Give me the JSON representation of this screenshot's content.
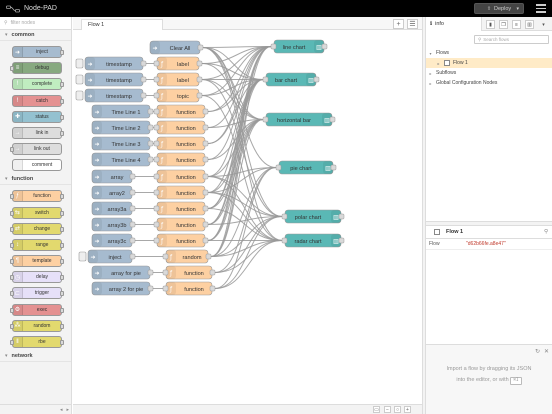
{
  "header": {
    "app_title": "Node-PAD",
    "deploy_label": "Deploy"
  },
  "palette": {
    "search_placeholder": "filter nodes",
    "categories": [
      {
        "name": "common",
        "nodes": [
          {
            "label": "inject",
            "color": "#a6bbcf",
            "icon": "arrow-right-icon"
          },
          {
            "label": "debug",
            "color": "#87a980",
            "icon": "bug-icon"
          },
          {
            "label": "complete",
            "color": "#c0edc0",
            "icon": "exclamation-icon"
          },
          {
            "label": "catch",
            "color": "#e49191",
            "icon": "exclamation-icon"
          },
          {
            "label": "status",
            "color": "#94c1d0",
            "icon": "status-icon"
          },
          {
            "label": "link in",
            "color": "#dddddd",
            "icon": "link-icon"
          },
          {
            "label": "link out",
            "color": "#dddddd",
            "icon": "link-icon"
          },
          {
            "label": "comment",
            "color": "#ffffff",
            "icon": "comment-icon"
          }
        ]
      },
      {
        "name": "function",
        "nodes": [
          {
            "label": "function",
            "color": "#fdd0a2",
            "icon": "function-icon"
          },
          {
            "label": "switch",
            "color": "#e2d96e",
            "icon": "switch-icon"
          },
          {
            "label": "change",
            "color": "#e2d96e",
            "icon": "change-icon"
          },
          {
            "label": "range",
            "color": "#e2d96e",
            "icon": "range-icon"
          },
          {
            "label": "template",
            "color": "#fdd0a2",
            "icon": "template-icon"
          },
          {
            "label": "delay",
            "color": "#e6e0f8",
            "icon": "clock-icon"
          },
          {
            "label": "trigger",
            "color": "#e6e0f8",
            "icon": "trigger-icon"
          },
          {
            "label": "exec",
            "color": "#e49191",
            "icon": "cog-icon"
          },
          {
            "label": "random",
            "color": "#e2d96e",
            "icon": "random-icon"
          },
          {
            "label": "rbe",
            "color": "#e2d96e",
            "icon": "rbe-icon"
          }
        ]
      },
      {
        "name": "network",
        "nodes": []
      }
    ]
  },
  "workspace": {
    "tab_label": "Flow 1",
    "add_tab": "+",
    "list_tabs": "☰",
    "zoom_out": "−",
    "zoom_reset": "○",
    "zoom_in": "+"
  },
  "flow": {
    "nodes": [
      {
        "id": "clear",
        "label": "Clear All",
        "type": "inject"
      },
      {
        "id": "ts1",
        "label": "timestamp",
        "type": "inject-btn"
      },
      {
        "id": "ts2",
        "label": "timestamp",
        "type": "inject-btn"
      },
      {
        "id": "ts3",
        "label": "timestamp",
        "type": "inject-btn"
      },
      {
        "id": "tl1",
        "label": "Time Line 1",
        "type": "inject"
      },
      {
        "id": "tl2",
        "label": "Time Line 2",
        "type": "inject"
      },
      {
        "id": "tl3",
        "label": "Time Line 3",
        "type": "inject"
      },
      {
        "id": "tl4",
        "label": "Time Line 4",
        "type": "inject"
      },
      {
        "id": "ar",
        "label": "array",
        "type": "inject"
      },
      {
        "id": "ar2",
        "label": "array2",
        "type": "inject"
      },
      {
        "id": "ar3a",
        "label": "array3a",
        "type": "inject"
      },
      {
        "id": "ar3b",
        "label": "array3b",
        "type": "inject"
      },
      {
        "id": "ar3c",
        "label": "array3c",
        "type": "inject"
      },
      {
        "id": "inj",
        "label": "inject",
        "type": "inject-btn"
      },
      {
        "id": "afp",
        "label": "array for pie",
        "type": "inject"
      },
      {
        "id": "a2p",
        "label": "array 2 for pie",
        "type": "inject"
      },
      {
        "id": "f_label1",
        "label": "label",
        "type": "function"
      },
      {
        "id": "f_label2",
        "label": "label",
        "type": "function"
      },
      {
        "id": "f_topic",
        "label": "topic",
        "type": "function"
      },
      {
        "id": "f1",
        "label": "function",
        "type": "function"
      },
      {
        "id": "f2",
        "label": "function",
        "type": "function"
      },
      {
        "id": "f3",
        "label": "function",
        "type": "function"
      },
      {
        "id": "f4",
        "label": "function",
        "type": "function"
      },
      {
        "id": "f5",
        "label": "function",
        "type": "function"
      },
      {
        "id": "f6",
        "label": "function",
        "type": "function"
      },
      {
        "id": "f7",
        "label": "function",
        "type": "function"
      },
      {
        "id": "f8",
        "label": "function",
        "type": "function"
      },
      {
        "id": "f9",
        "label": "function",
        "type": "function"
      },
      {
        "id": "rnd",
        "label": "random",
        "type": "function"
      },
      {
        "id": "fp1",
        "label": "function",
        "type": "function"
      },
      {
        "id": "fp2",
        "label": "function",
        "type": "function"
      },
      {
        "id": "c_line",
        "label": "line chart",
        "type": "chart"
      },
      {
        "id": "c_bar",
        "label": "bar chart",
        "type": "chart"
      },
      {
        "id": "c_hbar",
        "label": "horizontal bar",
        "type": "chart"
      },
      {
        "id": "c_pie",
        "label": "pie chart",
        "type": "chart"
      },
      {
        "id": "c_polar",
        "label": "polar chart",
        "type": "chart"
      },
      {
        "id": "c_radar",
        "label": "radar chart",
        "type": "chart"
      }
    ]
  },
  "sidebar": {
    "tab_label": "info",
    "search_placeholder": "Search flows",
    "tree": {
      "flows_label": "Flows",
      "flow1_label": "Flow 1",
      "subflows_label": "Subflows",
      "global_label": "Global Configuration Nodes"
    },
    "info": {
      "title": "Flow 1",
      "key": "Flow",
      "value": "\"d62b66fe.a8e47\""
    },
    "help": {
      "line1": "Import a flow by dragging its JSON",
      "line2": "into the editor, or with",
      "shortcut": "⌘I"
    }
  },
  "colors": {
    "inject": "#a6bbcf",
    "function": "#fdd0a2",
    "chart": "#5ab8b5",
    "wire": "#999999",
    "selected_flow": "#ffebc7",
    "info_value": "#c0392b"
  }
}
